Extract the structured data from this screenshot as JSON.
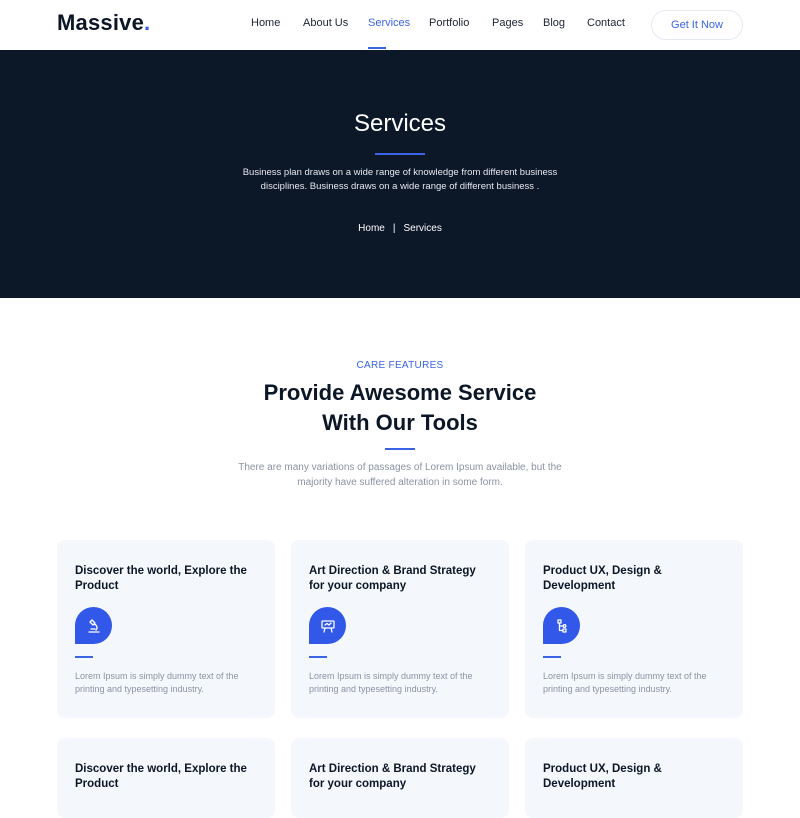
{
  "header": {
    "logo_text": "Massive",
    "logo_dot": ".",
    "nav": [
      {
        "label": "Home"
      },
      {
        "label": "About Us"
      },
      {
        "label": "Services",
        "active": true
      },
      {
        "label": "Portfolio"
      },
      {
        "label": "Pages"
      },
      {
        "label": "Blog"
      },
      {
        "label": "Contact"
      }
    ],
    "cta_label": "Get It Now"
  },
  "hero": {
    "title": "Services",
    "description": "Business plan draws on a wide range of knowledge from different business disciplines. Business draws on a wide range of different business .",
    "breadcrumb": {
      "home": "Home",
      "separator": "|",
      "current": "Services"
    }
  },
  "section": {
    "eyebrow": "CARE FEATURES",
    "title_line1": "Provide Awesome Service",
    "title_line2": "With Our Tools",
    "description": "There are many variations of passages of Lorem Ipsum available, but the majority have suffered alteration in some form."
  },
  "cards": [
    {
      "title": "Discover the world, Explore the Product",
      "icon": "microscope-icon",
      "text": "Lorem Ipsum is simply dummy text of the printing and typesetting industry."
    },
    {
      "title": "Art Direction & Brand Strategy for your company",
      "icon": "presentation-board-icon",
      "text": "Lorem Ipsum is simply dummy text of the printing and typesetting industry."
    },
    {
      "title": "Product UX, Design & Development",
      "icon": "flowchart-icon",
      "text": "Lorem Ipsum is simply dummy text of the printing and typesetting industry."
    },
    {
      "title": "Discover the world, Explore the Product"
    },
    {
      "title": "Art Direction & Brand Strategy for your company"
    },
    {
      "title": "Product UX, Design & Development"
    }
  ],
  "colors": {
    "accent": "#3a63e6",
    "hero_bg": "#0c1728",
    "card_bg": "#f4f7fc",
    "text_dark": "#0b1626",
    "text_muted": "#8a93a3"
  }
}
